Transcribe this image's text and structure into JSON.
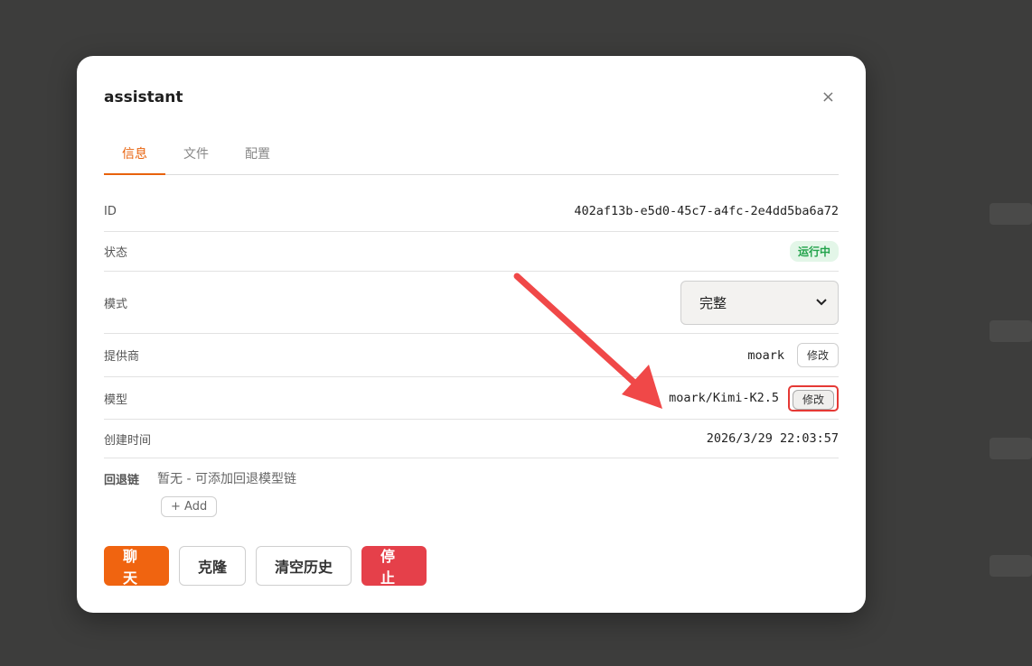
{
  "dialog": {
    "title": "assistant",
    "close_glyph": "×"
  },
  "tabs": [
    {
      "label": "信息",
      "active": true
    },
    {
      "label": "文件",
      "active": false
    },
    {
      "label": "配置",
      "active": false
    }
  ],
  "info": {
    "id": {
      "label": "ID",
      "value": "402af13b-e5d0-45c7-a4fc-2e4dd5ba6a72"
    },
    "status": {
      "label": "状态",
      "value": "运行中",
      "color": "#22a34b"
    },
    "mode": {
      "label": "模式",
      "value": "完整"
    },
    "provider": {
      "label": "提供商",
      "value": "moark",
      "edit_label": "修改"
    },
    "model": {
      "label": "模型",
      "value": "moark/Kimi-K2.5",
      "edit_label": "修改"
    },
    "created": {
      "label": "创建时间",
      "value": "2026/3/29 22:03:57"
    }
  },
  "fallback": {
    "label": "回退链",
    "empty_text": "暂无 - 可添加回退模型链",
    "add_label": "+ Add"
  },
  "actions": {
    "chat": "聊天",
    "clone": "克隆",
    "clear_history": "清空历史",
    "stop": "停止"
  },
  "colors": {
    "accent": "#e8620c",
    "chat_button": "#f06410",
    "stop_button": "#e5404a",
    "annotation": "#e53935"
  }
}
